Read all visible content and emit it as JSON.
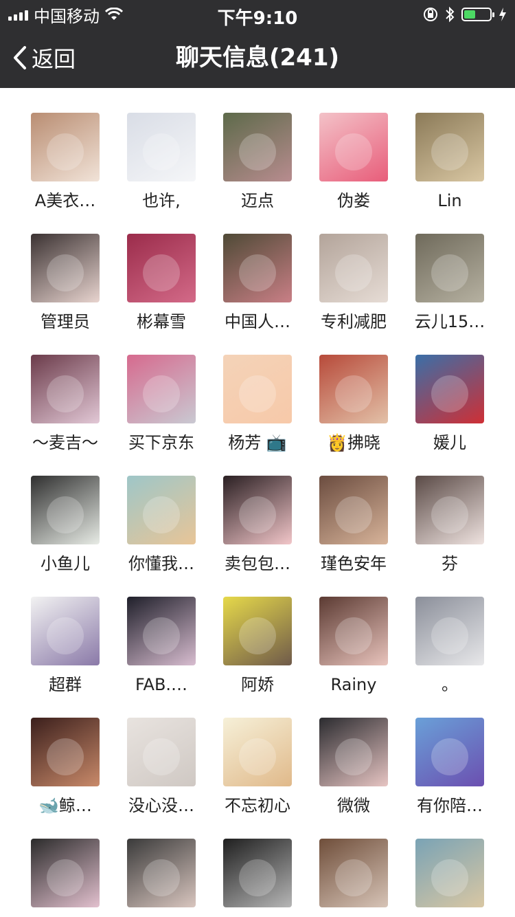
{
  "status_bar": {
    "carrier": "中国移动",
    "time": "下午9:10",
    "battery_level": 0.45
  },
  "nav": {
    "back_label": "返回",
    "title": "聊天信息(241)"
  },
  "members": [
    {
      "name": "A美衣…",
      "colors": [
        "#b98d72",
        "#f1e3d8"
      ]
    },
    {
      "name": "也许,",
      "colors": [
        "#d9dde6",
        "#f5f6f8"
      ]
    },
    {
      "name": "迈点",
      "colors": [
        "#5d6a4a",
        "#b88c8f"
      ]
    },
    {
      "name": "伪娄",
      "colors": [
        "#f3c2c8",
        "#e85d7a"
      ]
    },
    {
      "name": "Lin",
      "colors": [
        "#8b7a58",
        "#d9c7a3"
      ]
    },
    {
      "name": "管理员",
      "colors": [
        "#3b3232",
        "#e8d4cf"
      ]
    },
    {
      "name": "彬幕雪",
      "colors": [
        "#9b2c4b",
        "#d36a88"
      ]
    },
    {
      "name": "中国人…",
      "colors": [
        "#4f4a36",
        "#c97f86"
      ]
    },
    {
      "name": "专利减肥",
      "colors": [
        "#b3a49a",
        "#e6dcd5"
      ]
    },
    {
      "name": "云儿15…",
      "colors": [
        "#6f6a5b",
        "#b6b1a1"
      ]
    },
    {
      "name": "～麦吉～",
      "colors": [
        "#6b3b4a",
        "#e2c8d6"
      ]
    },
    {
      "name": "买下京东",
      "colors": [
        "#d66a8e",
        "#c9c9d2"
      ]
    },
    {
      "name": "杨芳 📺",
      "colors": [
        "#f4d3b8",
        "#f7c9a9"
      ]
    },
    {
      "name": "👸拂晓",
      "colors": [
        "#b74a3a",
        "#e3c1a8"
      ]
    },
    {
      "name": "媛儿",
      "colors": [
        "#3a6fa8",
        "#cf2f35"
      ]
    },
    {
      "name": "小鱼儿",
      "colors": [
        "#2f2f2f",
        "#e8ece6"
      ]
    },
    {
      "name": "你懂我…",
      "colors": [
        "#9ec6c8",
        "#e8c597"
      ]
    },
    {
      "name": "卖包包…",
      "colors": [
        "#2a1f22",
        "#f2c6c9"
      ]
    },
    {
      "name": "瑾色安年",
      "colors": [
        "#6b4c3f",
        "#d8b49a"
      ]
    },
    {
      "name": "芬",
      "colors": [
        "#5a4a46",
        "#efe3e0"
      ]
    },
    {
      "name": "超群",
      "colors": [
        "#f2f2f2",
        "#8a79a8"
      ]
    },
    {
      "name": "FAB.…",
      "colors": [
        "#1f1f2a",
        "#d8bdd0"
      ]
    },
    {
      "name": "阿娇",
      "colors": [
        "#e6d94a",
        "#6f5a4a"
      ]
    },
    {
      "name": "Rainy",
      "colors": [
        "#5b3a32",
        "#e9c4bd"
      ]
    },
    {
      "name": "。",
      "colors": [
        "#8b8f9a",
        "#e8e8ea"
      ]
    },
    {
      "name": "🐋鲸…",
      "colors": [
        "#3b1f1c",
        "#c98a6a"
      ]
    },
    {
      "name": "没心没…",
      "colors": [
        "#e8e3df",
        "#cfc8c3"
      ]
    },
    {
      "name": "不忘初心",
      "colors": [
        "#f6f0d8",
        "#e0b98a"
      ]
    },
    {
      "name": "微微",
      "colors": [
        "#2b2b2f",
        "#e7c5c3"
      ]
    },
    {
      "name": "有你陪…",
      "colors": [
        "#6aa0d8",
        "#6b4fb0"
      ]
    },
    {
      "name": "",
      "colors": [
        "#2b2b2b",
        "#e3c1cf"
      ]
    },
    {
      "name": "",
      "colors": [
        "#3a3a3a",
        "#d9c6bf"
      ]
    },
    {
      "name": "",
      "colors": [
        "#1f1f1f",
        "#b6b6b6"
      ]
    },
    {
      "name": "",
      "colors": [
        "#6f4e3a",
        "#d7c4b7"
      ]
    },
    {
      "name": "",
      "colors": [
        "#7aa3b5",
        "#d9c7a3"
      ]
    }
  ]
}
